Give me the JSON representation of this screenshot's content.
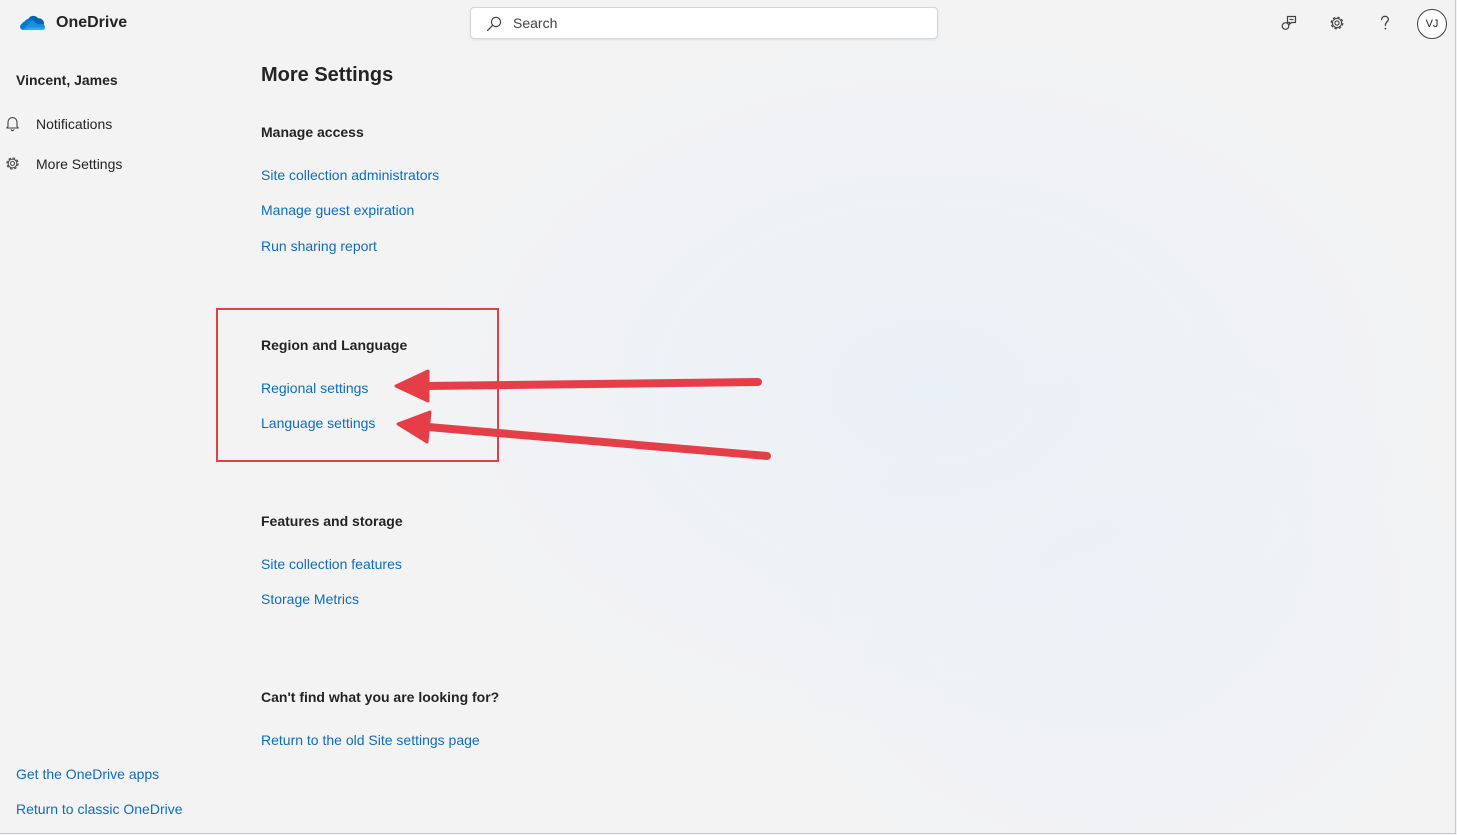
{
  "app": {
    "name": "OneDrive"
  },
  "header": {
    "search_placeholder": "Search",
    "avatar_initials": "VJ"
  },
  "sidebar": {
    "user_name": "Vincent, James",
    "items": [
      {
        "label": "Notifications",
        "icon": "bell-icon"
      },
      {
        "label": "More Settings",
        "icon": "gear-icon"
      }
    ],
    "bottom_links": [
      "Get the OneDrive apps",
      "Return to classic OneDrive"
    ]
  },
  "main": {
    "title": "More Settings",
    "sections": [
      {
        "heading": "Manage access",
        "links": [
          "Site collection administrators",
          "Manage guest expiration",
          "Run sharing report"
        ]
      },
      {
        "heading": "Region and Language",
        "links": [
          "Regional settings",
          "Language settings"
        ]
      },
      {
        "heading": "Features and storage",
        "links": [
          "Site collection features",
          "Storage Metrics"
        ]
      },
      {
        "heading": "Can't find what you are looking for?",
        "links": [
          "Return to the old Site settings page"
        ]
      }
    ]
  },
  "colors": {
    "link": "#0f6cbd",
    "text": "#242424",
    "annotation": "#e43f48",
    "brand_blue": "#0364b8"
  }
}
